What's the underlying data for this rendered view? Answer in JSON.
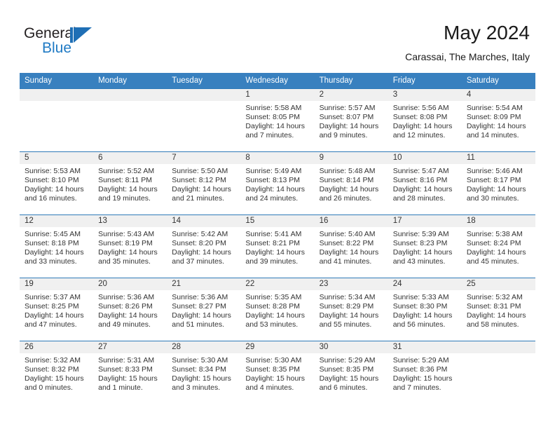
{
  "brand": {
    "name_part1": "General",
    "name_part2": "Blue",
    "mark_icon": "triangle-flag-icon",
    "accent_color": "#1f7ac4"
  },
  "header": {
    "month_title": "May 2024",
    "location": "Carassai, The Marches, Italy"
  },
  "theme": {
    "header_blue": "#3880bf",
    "row_divider_blue": "#2f7ab8",
    "daynum_band_gray": "#f0f0f0",
    "text_color": "#333333"
  },
  "calendar": {
    "weekday_headers": [
      "Sunday",
      "Monday",
      "Tuesday",
      "Wednesday",
      "Thursday",
      "Friday",
      "Saturday"
    ],
    "weeks": [
      [
        {
          "day": "",
          "empty": true
        },
        {
          "day": "",
          "empty": true
        },
        {
          "day": "",
          "empty": true
        },
        {
          "day": "1",
          "sunrise": "Sunrise: 5:58 AM",
          "sunset": "Sunset: 8:05 PM",
          "daylight_line1": "Daylight: 14 hours",
          "daylight_line2": "and 7 minutes."
        },
        {
          "day": "2",
          "sunrise": "Sunrise: 5:57 AM",
          "sunset": "Sunset: 8:07 PM",
          "daylight_line1": "Daylight: 14 hours",
          "daylight_line2": "and 9 minutes."
        },
        {
          "day": "3",
          "sunrise": "Sunrise: 5:56 AM",
          "sunset": "Sunset: 8:08 PM",
          "daylight_line1": "Daylight: 14 hours",
          "daylight_line2": "and 12 minutes."
        },
        {
          "day": "4",
          "sunrise": "Sunrise: 5:54 AM",
          "sunset": "Sunset: 8:09 PM",
          "daylight_line1": "Daylight: 14 hours",
          "daylight_line2": "and 14 minutes."
        }
      ],
      [
        {
          "day": "5",
          "sunrise": "Sunrise: 5:53 AM",
          "sunset": "Sunset: 8:10 PM",
          "daylight_line1": "Daylight: 14 hours",
          "daylight_line2": "and 16 minutes."
        },
        {
          "day": "6",
          "sunrise": "Sunrise: 5:52 AM",
          "sunset": "Sunset: 8:11 PM",
          "daylight_line1": "Daylight: 14 hours",
          "daylight_line2": "and 19 minutes."
        },
        {
          "day": "7",
          "sunrise": "Sunrise: 5:50 AM",
          "sunset": "Sunset: 8:12 PM",
          "daylight_line1": "Daylight: 14 hours",
          "daylight_line2": "and 21 minutes."
        },
        {
          "day": "8",
          "sunrise": "Sunrise: 5:49 AM",
          "sunset": "Sunset: 8:13 PM",
          "daylight_line1": "Daylight: 14 hours",
          "daylight_line2": "and 24 minutes."
        },
        {
          "day": "9",
          "sunrise": "Sunrise: 5:48 AM",
          "sunset": "Sunset: 8:14 PM",
          "daylight_line1": "Daylight: 14 hours",
          "daylight_line2": "and 26 minutes."
        },
        {
          "day": "10",
          "sunrise": "Sunrise: 5:47 AM",
          "sunset": "Sunset: 8:16 PM",
          "daylight_line1": "Daylight: 14 hours",
          "daylight_line2": "and 28 minutes."
        },
        {
          "day": "11",
          "sunrise": "Sunrise: 5:46 AM",
          "sunset": "Sunset: 8:17 PM",
          "daylight_line1": "Daylight: 14 hours",
          "daylight_line2": "and 30 minutes."
        }
      ],
      [
        {
          "day": "12",
          "sunrise": "Sunrise: 5:45 AM",
          "sunset": "Sunset: 8:18 PM",
          "daylight_line1": "Daylight: 14 hours",
          "daylight_line2": "and 33 minutes."
        },
        {
          "day": "13",
          "sunrise": "Sunrise: 5:43 AM",
          "sunset": "Sunset: 8:19 PM",
          "daylight_line1": "Daylight: 14 hours",
          "daylight_line2": "and 35 minutes."
        },
        {
          "day": "14",
          "sunrise": "Sunrise: 5:42 AM",
          "sunset": "Sunset: 8:20 PM",
          "daylight_line1": "Daylight: 14 hours",
          "daylight_line2": "and 37 minutes."
        },
        {
          "day": "15",
          "sunrise": "Sunrise: 5:41 AM",
          "sunset": "Sunset: 8:21 PM",
          "daylight_line1": "Daylight: 14 hours",
          "daylight_line2": "and 39 minutes."
        },
        {
          "day": "16",
          "sunrise": "Sunrise: 5:40 AM",
          "sunset": "Sunset: 8:22 PM",
          "daylight_line1": "Daylight: 14 hours",
          "daylight_line2": "and 41 minutes."
        },
        {
          "day": "17",
          "sunrise": "Sunrise: 5:39 AM",
          "sunset": "Sunset: 8:23 PM",
          "daylight_line1": "Daylight: 14 hours",
          "daylight_line2": "and 43 minutes."
        },
        {
          "day": "18",
          "sunrise": "Sunrise: 5:38 AM",
          "sunset": "Sunset: 8:24 PM",
          "daylight_line1": "Daylight: 14 hours",
          "daylight_line2": "and 45 minutes."
        }
      ],
      [
        {
          "day": "19",
          "sunrise": "Sunrise: 5:37 AM",
          "sunset": "Sunset: 8:25 PM",
          "daylight_line1": "Daylight: 14 hours",
          "daylight_line2": "and 47 minutes."
        },
        {
          "day": "20",
          "sunrise": "Sunrise: 5:36 AM",
          "sunset": "Sunset: 8:26 PM",
          "daylight_line1": "Daylight: 14 hours",
          "daylight_line2": "and 49 minutes."
        },
        {
          "day": "21",
          "sunrise": "Sunrise: 5:36 AM",
          "sunset": "Sunset: 8:27 PM",
          "daylight_line1": "Daylight: 14 hours",
          "daylight_line2": "and 51 minutes."
        },
        {
          "day": "22",
          "sunrise": "Sunrise: 5:35 AM",
          "sunset": "Sunset: 8:28 PM",
          "daylight_line1": "Daylight: 14 hours",
          "daylight_line2": "and 53 minutes."
        },
        {
          "day": "23",
          "sunrise": "Sunrise: 5:34 AM",
          "sunset": "Sunset: 8:29 PM",
          "daylight_line1": "Daylight: 14 hours",
          "daylight_line2": "and 55 minutes."
        },
        {
          "day": "24",
          "sunrise": "Sunrise: 5:33 AM",
          "sunset": "Sunset: 8:30 PM",
          "daylight_line1": "Daylight: 14 hours",
          "daylight_line2": "and 56 minutes."
        },
        {
          "day": "25",
          "sunrise": "Sunrise: 5:32 AM",
          "sunset": "Sunset: 8:31 PM",
          "daylight_line1": "Daylight: 14 hours",
          "daylight_line2": "and 58 minutes."
        }
      ],
      [
        {
          "day": "26",
          "sunrise": "Sunrise: 5:32 AM",
          "sunset": "Sunset: 8:32 PM",
          "daylight_line1": "Daylight: 15 hours",
          "daylight_line2": "and 0 minutes."
        },
        {
          "day": "27",
          "sunrise": "Sunrise: 5:31 AM",
          "sunset": "Sunset: 8:33 PM",
          "daylight_line1": "Daylight: 15 hours",
          "daylight_line2": "and 1 minute."
        },
        {
          "day": "28",
          "sunrise": "Sunrise: 5:30 AM",
          "sunset": "Sunset: 8:34 PM",
          "daylight_line1": "Daylight: 15 hours",
          "daylight_line2": "and 3 minutes."
        },
        {
          "day": "29",
          "sunrise": "Sunrise: 5:30 AM",
          "sunset": "Sunset: 8:35 PM",
          "daylight_line1": "Daylight: 15 hours",
          "daylight_line2": "and 4 minutes."
        },
        {
          "day": "30",
          "sunrise": "Sunrise: 5:29 AM",
          "sunset": "Sunset: 8:35 PM",
          "daylight_line1": "Daylight: 15 hours",
          "daylight_line2": "and 6 minutes."
        },
        {
          "day": "31",
          "sunrise": "Sunrise: 5:29 AM",
          "sunset": "Sunset: 8:36 PM",
          "daylight_line1": "Daylight: 15 hours",
          "daylight_line2": "and 7 minutes."
        },
        {
          "day": "",
          "empty": true
        }
      ]
    ]
  }
}
